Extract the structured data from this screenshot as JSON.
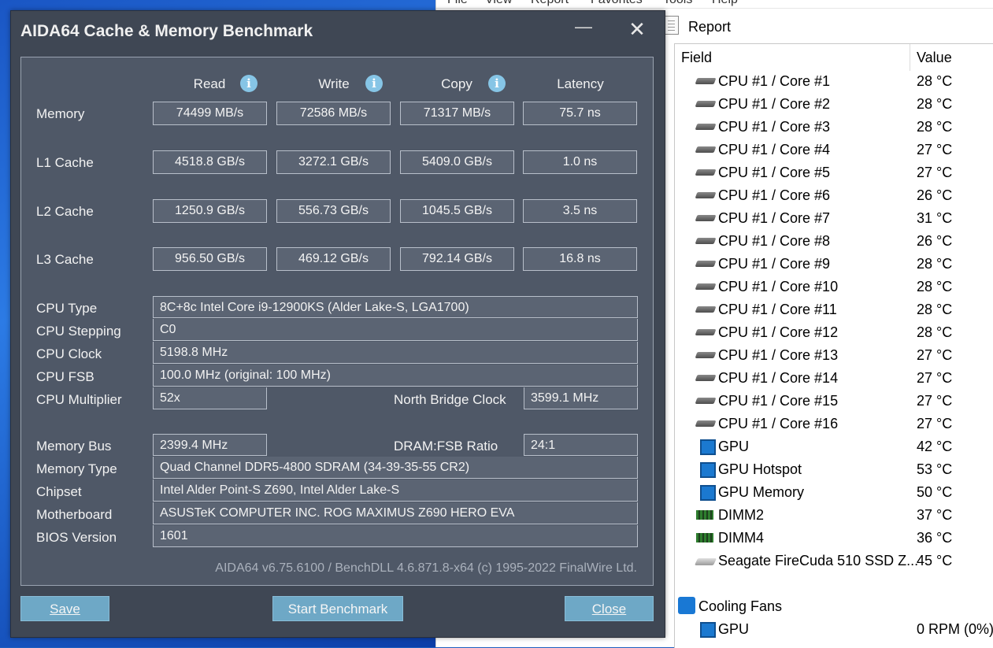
{
  "report_window": {
    "menu": [
      "File",
      "View",
      "Report",
      "Favorites",
      "Tools",
      "Help"
    ],
    "toolbar_title": "Report",
    "columns": {
      "field": "Field",
      "value": "Value"
    },
    "rows": [
      {
        "icon": "cpu-icon",
        "label": "CPU #1 / Core #1",
        "value": "28 °C"
      },
      {
        "icon": "cpu-icon",
        "label": "CPU #1 / Core #2",
        "value": "28 °C"
      },
      {
        "icon": "cpu-icon",
        "label": "CPU #1 / Core #3",
        "value": "28 °C"
      },
      {
        "icon": "cpu-icon",
        "label": "CPU #1 / Core #4",
        "value": "27 °C"
      },
      {
        "icon": "cpu-icon",
        "label": "CPU #1 / Core #5",
        "value": "27 °C"
      },
      {
        "icon": "cpu-icon",
        "label": "CPU #1 / Core #6",
        "value": "26 °C"
      },
      {
        "icon": "cpu-icon",
        "label": "CPU #1 / Core #7",
        "value": "31 °C"
      },
      {
        "icon": "cpu-icon",
        "label": "CPU #1 / Core #8",
        "value": "26 °C"
      },
      {
        "icon": "cpu-icon",
        "label": "CPU #1 / Core #9",
        "value": "28 °C"
      },
      {
        "icon": "cpu-icon",
        "label": "CPU #1 / Core #10",
        "value": "28 °C"
      },
      {
        "icon": "cpu-icon",
        "label": "CPU #1 / Core #11",
        "value": "28 °C"
      },
      {
        "icon": "cpu-icon",
        "label": "CPU #1 / Core #12",
        "value": "28 °C"
      },
      {
        "icon": "cpu-icon",
        "label": "CPU #1 / Core #13",
        "value": "27 °C"
      },
      {
        "icon": "cpu-icon",
        "label": "CPU #1 / Core #14",
        "value": "27 °C"
      },
      {
        "icon": "cpu-icon",
        "label": "CPU #1 / Core #15",
        "value": "27 °C"
      },
      {
        "icon": "cpu-icon",
        "label": "CPU #1 / Core #16",
        "value": "27 °C"
      },
      {
        "icon": "gpu-icon",
        "label": "GPU",
        "value": "42 °C"
      },
      {
        "icon": "gpu-icon",
        "label": "GPU Hotspot",
        "value": "53 °C"
      },
      {
        "icon": "gpu-icon",
        "label": "GPU Memory",
        "value": "50 °C"
      },
      {
        "icon": "dimm-icon",
        "label": "DIMM2",
        "value": "37 °C"
      },
      {
        "icon": "dimm-icon",
        "label": "DIMM4",
        "value": "36 °C"
      },
      {
        "icon": "ssd-icon",
        "label": "Seagate FireCuda 510 SSD Z...",
        "value": "45 °C"
      }
    ],
    "group_cooling": "Cooling Fans",
    "fan_rows": [
      {
        "icon": "gpu-icon",
        "label": "GPU",
        "value": "0 RPM  (0%)"
      }
    ]
  },
  "dialog": {
    "title": "AIDA64 Cache & Memory Benchmark",
    "columns": [
      "Read",
      "Write",
      "Copy",
      "Latency"
    ],
    "bench_rows": [
      {
        "label": "Memory",
        "values": [
          "74499 MB/s",
          "72586 MB/s",
          "71317 MB/s",
          "75.7 ns"
        ]
      },
      {
        "label": "L1 Cache",
        "values": [
          "4518.8 GB/s",
          "3272.1 GB/s",
          "5409.0 GB/s",
          "1.0 ns"
        ]
      },
      {
        "label": "L2 Cache",
        "values": [
          "1250.9 GB/s",
          "556.73 GB/s",
          "1045.5 GB/s",
          "3.5 ns"
        ]
      },
      {
        "label": "L3 Cache",
        "values": [
          "956.50 GB/s",
          "469.12 GB/s",
          "792.14 GB/s",
          "16.8 ns"
        ]
      }
    ],
    "cpu_info": [
      {
        "label": "CPU Type",
        "value": "8C+8c Intel Core i9-12900KS  (Alder Lake-S, LGA1700)"
      },
      {
        "label": "CPU Stepping",
        "value": "C0"
      },
      {
        "label": "CPU Clock",
        "value": "5198.8 MHz"
      },
      {
        "label": "CPU FSB",
        "value": "100.0 MHz  (original: 100 MHz)"
      }
    ],
    "cpu_multiplier": {
      "label": "CPU Multiplier",
      "value": "52x",
      "nb_label": "North Bridge Clock",
      "nb_value": "3599.1 MHz"
    },
    "memory_bus": {
      "label": "Memory Bus",
      "value": "2399.4 MHz",
      "ratio_label": "DRAM:FSB Ratio",
      "ratio_value": "24:1"
    },
    "board_info": [
      {
        "label": "Memory Type",
        "value": "Quad Channel DDR5-4800 SDRAM  (34-39-35-55 CR2)"
      },
      {
        "label": "Chipset",
        "value": "Intel Alder Point-S Z690, Intel Alder Lake-S"
      },
      {
        "label": "Motherboard",
        "value": "ASUSTeK COMPUTER INC. ROG MAXIMUS Z690 HERO EVA"
      },
      {
        "label": "BIOS Version",
        "value": "1601"
      }
    ],
    "footer": "AIDA64 v6.75.6100 / BenchDLL 4.6.871.8-x64  (c) 1995-2022 FinalWire Ltd.",
    "buttons": {
      "save": "Save",
      "start": "Start Benchmark",
      "close": "Close"
    }
  }
}
